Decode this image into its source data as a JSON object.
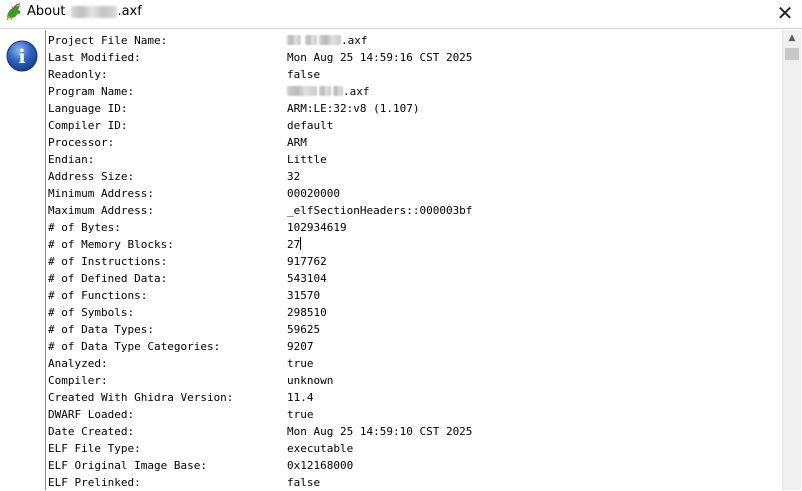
{
  "window": {
    "title_prefix": "About",
    "title_suffix": ".axf",
    "app_icon": "dragon-icon",
    "close_icon": "close-icon",
    "close_glyph": "✕"
  },
  "info": {
    "icon": "info-icon",
    "icon_letter": "i"
  },
  "properties": [
    {
      "key": "Project File Name:",
      "value": ".axf"
    },
    {
      "key": "Last Modified:",
      "value": "Mon Aug 25 14:59:16 CST 2025"
    },
    {
      "key": "Readonly:",
      "value": "false"
    },
    {
      "key": "Program Name:",
      "value": ".axf"
    },
    {
      "key": "Language ID:",
      "value": "ARM:LE:32:v8 (1.107)"
    },
    {
      "key": "Compiler ID:",
      "value": "default"
    },
    {
      "key": "Processor:",
      "value": "ARM"
    },
    {
      "key": "Endian:",
      "value": "Little"
    },
    {
      "key": "Address Size:",
      "value": "32"
    },
    {
      "key": "Minimum Address:",
      "value": "00020000"
    },
    {
      "key": "Maximum Address:",
      "value": "_elfSectionHeaders::000003bf"
    },
    {
      "key": "# of Bytes:",
      "value": "102934619"
    },
    {
      "key": "# of Memory Blocks:",
      "value": "27"
    },
    {
      "key": "# of Instructions:",
      "value": "917762"
    },
    {
      "key": "# of Defined Data:",
      "value": "543104"
    },
    {
      "key": "# of Functions:",
      "value": "31570"
    },
    {
      "key": "# of Symbols:",
      "value": "298510"
    },
    {
      "key": "# of Data Types:",
      "value": "59625"
    },
    {
      "key": "# of Data Type Categories:",
      "value": "9207"
    },
    {
      "key": "Analyzed:",
      "value": "true"
    },
    {
      "key": "Compiler:",
      "value": "unknown"
    },
    {
      "key": "Created With Ghidra Version:",
      "value": "11.4"
    },
    {
      "key": "DWARF Loaded:",
      "value": "true"
    },
    {
      "key": "Date Created:",
      "value": "Mon Aug 25 14:59:10 CST 2025"
    },
    {
      "key": "ELF File Type:",
      "value": "executable"
    },
    {
      "key": "ELF Original Image Base:",
      "value": "0x12168000"
    },
    {
      "key": "ELF Prelinked:",
      "value": "false"
    }
  ],
  "scrollbar": {
    "up_icon": "scroll-up-arrow-icon",
    "up_glyph": "▲"
  }
}
